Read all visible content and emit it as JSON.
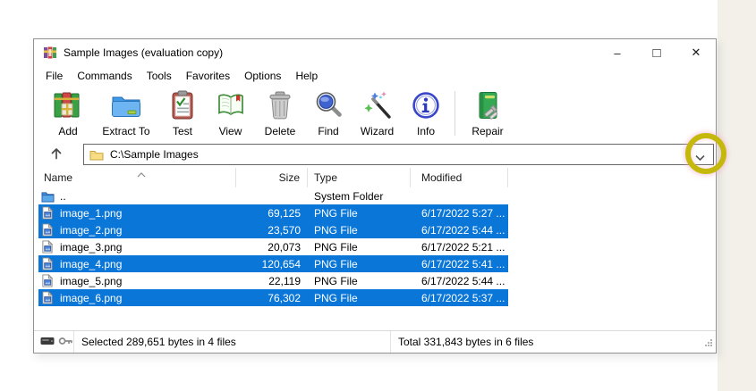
{
  "window": {
    "title": "Sample Images (evaluation copy)",
    "controls": {
      "minimize": "–",
      "maximize": "□",
      "close": "✕"
    }
  },
  "menu": {
    "items": [
      "File",
      "Commands",
      "Tools",
      "Favorites",
      "Options",
      "Help"
    ]
  },
  "toolbar": {
    "buttons": [
      {
        "label": "Add",
        "icon": "add-archive-books-icon"
      },
      {
        "label": "Extract To",
        "icon": "extract-folder-icon"
      },
      {
        "label": "Test",
        "icon": "test-clipboard-check-icon"
      },
      {
        "label": "View",
        "icon": "view-open-book-icon"
      },
      {
        "label": "Delete",
        "icon": "delete-trash-icon"
      },
      {
        "label": "Find",
        "icon": "find-magnifier-icon"
      },
      {
        "label": "Wizard",
        "icon": "wizard-wand-icon"
      },
      {
        "label": "Info",
        "icon": "info-circle-icon"
      },
      {
        "label": "Repair",
        "icon": "repair-book-bolt-icon"
      }
    ]
  },
  "address_bar": {
    "path": "C:\\Sample Images"
  },
  "file_list": {
    "columns": {
      "name": "Name",
      "size": "Size",
      "type": "Type",
      "modified": "Modified"
    },
    "sort": {
      "column": "Name",
      "direction": "ascending"
    },
    "rows": [
      {
        "name": "..",
        "size": "",
        "type": "System Folder",
        "modified": "",
        "selected": false
      },
      {
        "name": "image_1.png",
        "size": "69,125",
        "type": "PNG File",
        "modified": "6/17/2022 5:27 ...",
        "selected": true
      },
      {
        "name": "image_2.png",
        "size": "23,570",
        "type": "PNG File",
        "modified": "6/17/2022 5:44 ...",
        "selected": true
      },
      {
        "name": "image_3.png",
        "size": "20,073",
        "type": "PNG File",
        "modified": "6/17/2022 5:21 ...",
        "selected": false
      },
      {
        "name": "image_4.png",
        "size": "120,654",
        "type": "PNG File",
        "modified": "6/17/2022 5:41 ...",
        "selected": true
      },
      {
        "name": "image_5.png",
        "size": "22,119",
        "type": "PNG File",
        "modified": "6/17/2022 5:44 ...",
        "selected": false
      },
      {
        "name": "image_6.png",
        "size": "76,302",
        "type": "PNG File",
        "modified": "6/17/2022 5:37 ...",
        "selected": true
      }
    ]
  },
  "status_bar": {
    "selected_info": "Selected 289,651 bytes in 4 files",
    "total_info": "Total 331,843 bytes in 6 files"
  },
  "annotation": {
    "type": "highlight-circle",
    "target": "address-history-dropdown",
    "color": "#c4b80c"
  },
  "icons": {
    "app_icon": "winrar-books",
    "up_button": "arrow-up",
    "address_folder": "yellow-folder",
    "address_dropdown": "chevron-down",
    "sort_indicator": "chevron-up",
    "updir_row": "blue-folder-up",
    "file_row": "image-file",
    "statusbar_disk": "disk",
    "statusbar_key": "key",
    "resize_grip": "grip-dots"
  },
  "colors": {
    "selection_bg": "#0a76d8",
    "selection_text": "#ffffff"
  }
}
